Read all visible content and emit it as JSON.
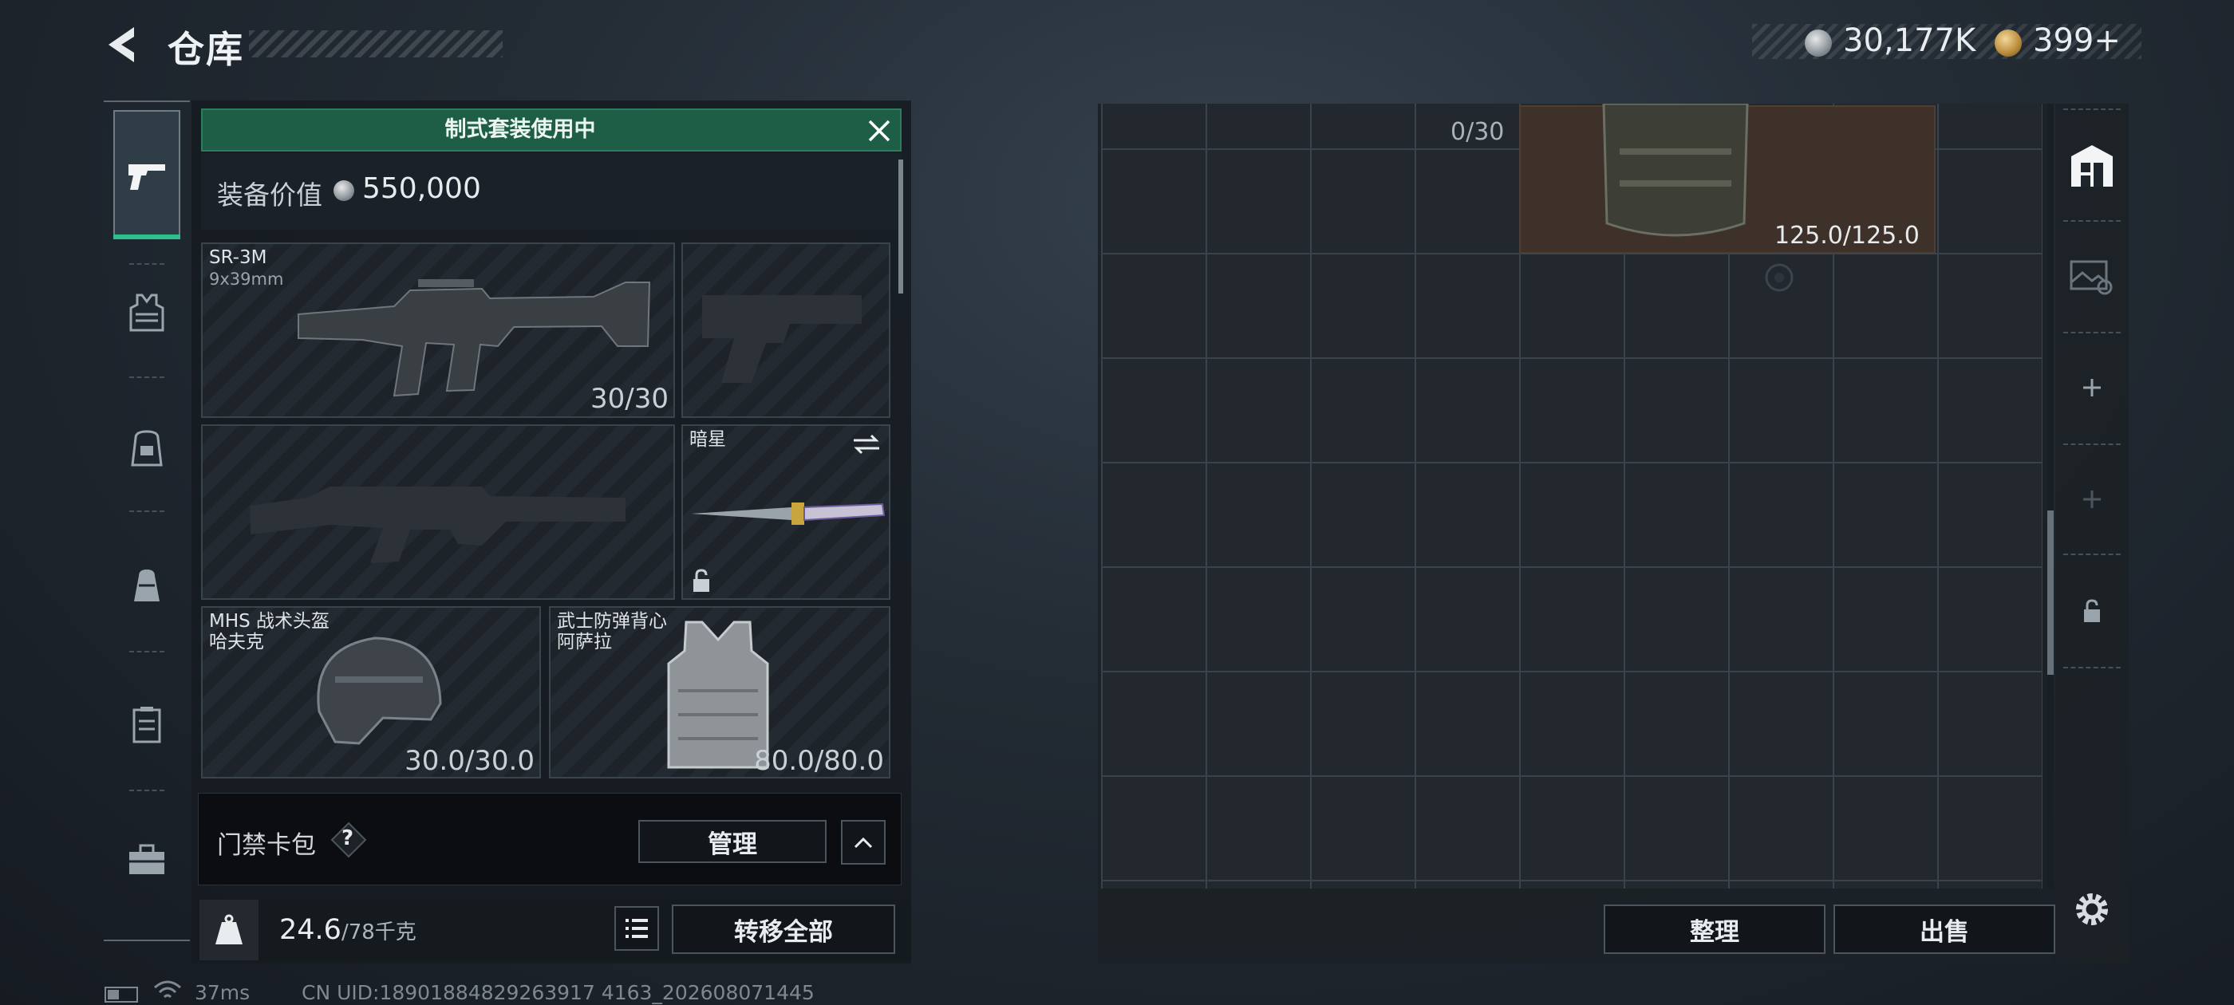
{
  "header": {
    "title": "仓库",
    "currency_silver": "30,177K",
    "currency_gold": "399+",
    "silver_icon": "silver-coin-icon",
    "gold_icon": "gold-coin-icon"
  },
  "left_nav": {
    "items": [
      "pistol-icon",
      "vest-icon",
      "backpack-rig-icon",
      "backpack-icon",
      "container-icon",
      "briefcase-icon"
    ],
    "active_index": 0,
    "accent_color": "#2fbf8d"
  },
  "loadout": {
    "banner": "制式套装使用中",
    "value_label": "装备价值",
    "value": "550,000",
    "primary_weapon": {
      "name": "SR-3M",
      "caliber": "9x39mm",
      "ammo": "30/30"
    },
    "melee": {
      "name": "暗星"
    },
    "helmet": {
      "name": "MHS 战术头盔",
      "variant": "哈夫克",
      "durability": "30.0/30.0"
    },
    "armor": {
      "name": "武士防弹背心",
      "variant": "阿萨拉",
      "durability": "80.0/80.0"
    },
    "card_pack": {
      "label": "门禁卡包",
      "help": "?",
      "manage": "管理"
    },
    "weight": {
      "current": "24.6",
      "max_unit": "/78千克"
    },
    "transfer_all": "转移全部"
  },
  "storage": {
    "item_partial_count": "0/30",
    "item_durability": "125.0/125.0",
    "sort_label": "整理",
    "sell_label": "出售"
  },
  "right_rail": {
    "items": [
      "storage-tab-icon",
      "gallery-tab-icon",
      "add-tab-icon",
      "add-tab-disabled-icon",
      "lock-tab-icon"
    ]
  },
  "status": {
    "ping": "37ms",
    "uid": "CN UID:18901884829263917 4163_202608071445"
  },
  "colors": {
    "banner_bg": "#1e5e47",
    "storage_item_bg": "#3d3129"
  }
}
